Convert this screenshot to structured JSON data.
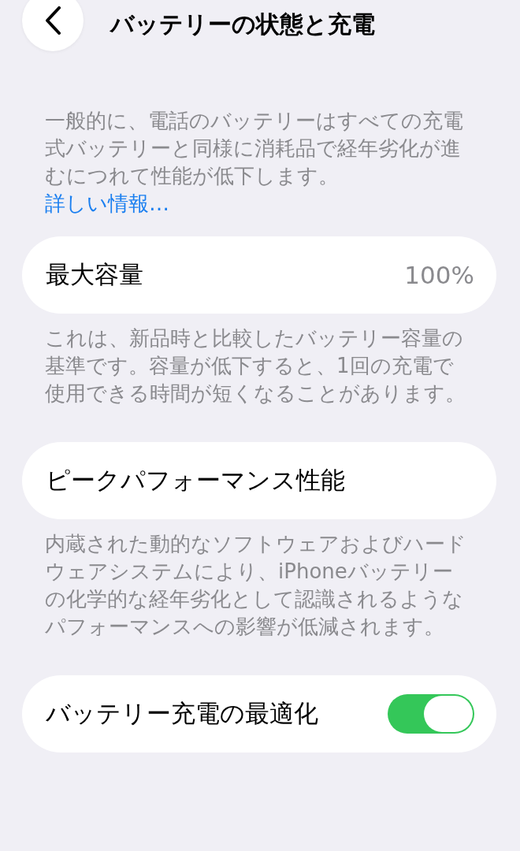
{
  "header": {
    "title": "バッテリーの状態と充電"
  },
  "intro": {
    "text": "一般的に、電話のバッテリーはすべての充電式バッテリーと同様に消耗品で経年劣化が進むにつれて性能が低下します。",
    "link": "詳しい情報…"
  },
  "sections": [
    {
      "kind": "value",
      "label": "最大容量",
      "value": "100%",
      "footer": "これは、新品時と比較したバッテリー容量の基準です。容量が低下すると、1回の充電で使用できる時間が短くなることがあります。"
    },
    {
      "kind": "plain",
      "label": "ピークパフォーマンス性能",
      "footer": "内蔵された動的なソフトウェアおよびハードウェアシステムにより、iPhoneバッテリーの化学的な経年劣化として認識されるようなパフォーマンスへの影響が低減されます。"
    },
    {
      "kind": "toggle",
      "label": "バッテリー充電の最適化",
      "on": true
    }
  ]
}
